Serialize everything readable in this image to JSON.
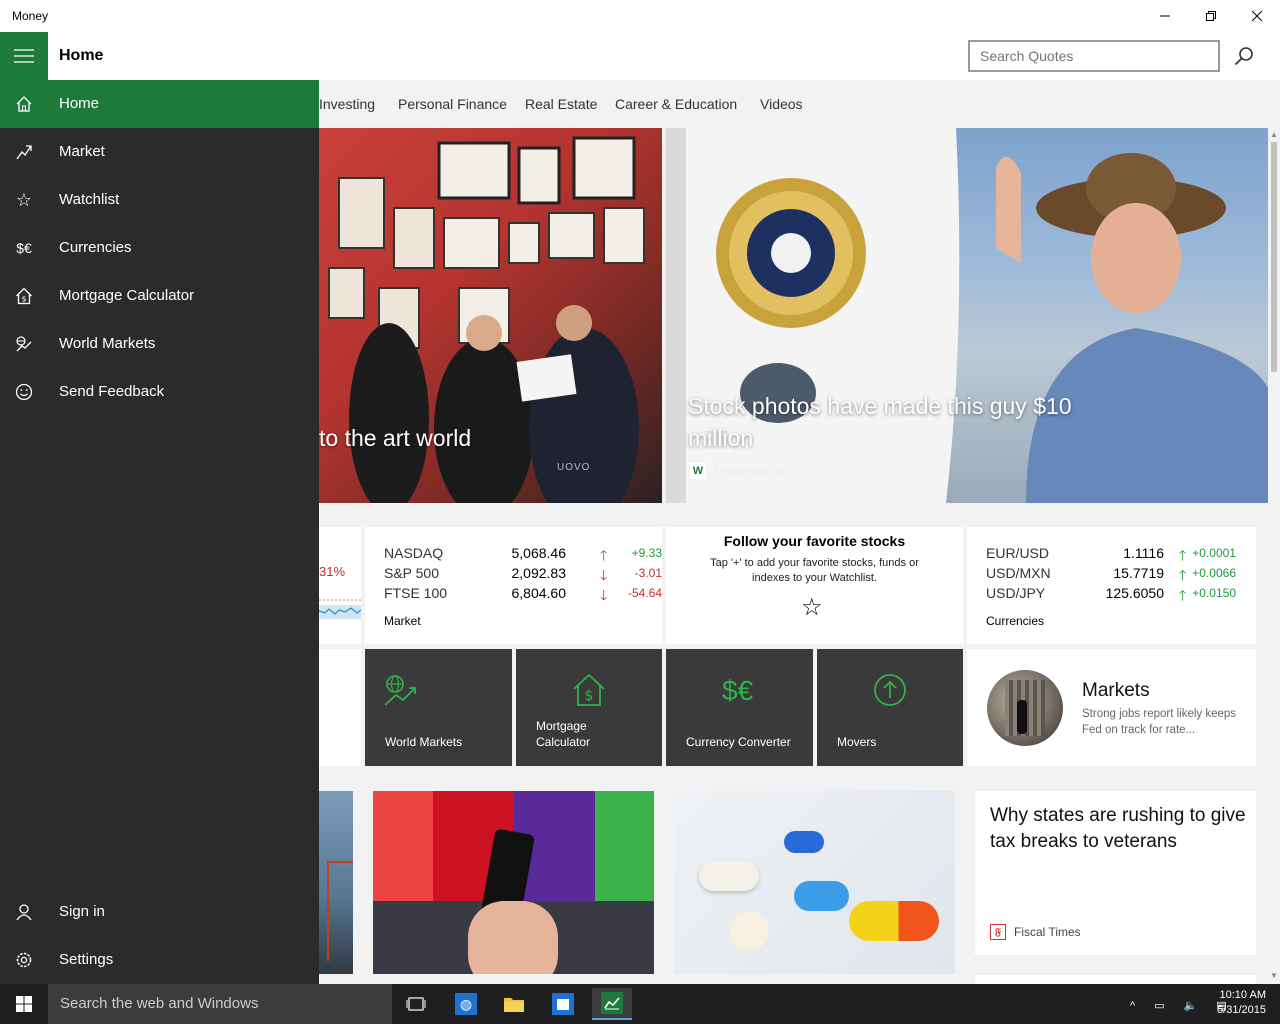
{
  "window": {
    "title": "Money"
  },
  "header": {
    "title": "Home",
    "search_placeholder": "Search Quotes"
  },
  "tabs": [
    "Investing",
    "Personal Finance",
    "Real Estate",
    "Career & Education",
    "Videos"
  ],
  "hero": {
    "left_headline": "to the art world",
    "right_headline": "Stock photos have made this guy $10 million",
    "right_source": "MarketWatch",
    "left_watermark": "UOVO"
  },
  "market_card": {
    "partial_pct": "31%",
    "rows": [
      {
        "name": "NASDAQ",
        "value": "5,068.46",
        "direction": "up",
        "change": "+9.33"
      },
      {
        "name": "S&P 500",
        "value": "2,092.83",
        "direction": "down",
        "change": "-3.01"
      },
      {
        "name": "FTSE 100",
        "value": "6,804.60",
        "direction": "down",
        "change": "-54.64"
      }
    ],
    "label": "Market"
  },
  "watchlist_card": {
    "title": "Follow your favorite stocks",
    "body": "Tap '+' to add your favorite stocks, funds or indexes to your Watchlist."
  },
  "currencies_card": {
    "rows": [
      {
        "name": "EUR/USD",
        "value": "1.1116",
        "direction": "up",
        "change": "+0.0001"
      },
      {
        "name": "USD/MXN",
        "value": "15.7719",
        "direction": "up",
        "change": "+0.0066"
      },
      {
        "name": "USD/JPY",
        "value": "125.6050",
        "direction": "up",
        "change": "+0.0150"
      }
    ],
    "label": "Currencies"
  },
  "tiles": {
    "world_markets": "World Markets",
    "mortgage_line1": "Mortgage",
    "mortgage_line2": "Calculator",
    "currency_converter": "Currency Converter",
    "movers": "Movers"
  },
  "markets_news": {
    "title": "Markets",
    "body": "Strong jobs report likely keeps Fed on track for rate..."
  },
  "article": {
    "headline": "Why states are rushing to give tax breaks to veterans",
    "source": "Fiscal Times"
  },
  "nav": {
    "items": [
      {
        "label": "Home",
        "icon": "home-icon"
      },
      {
        "label": "Market",
        "icon": "market-chart-icon"
      },
      {
        "label": "Watchlist",
        "icon": "star-icon"
      },
      {
        "label": "Currencies",
        "icon": "currency-icon"
      },
      {
        "label": "Mortgage Calculator",
        "icon": "mortgage-icon"
      },
      {
        "label": "World Markets",
        "icon": "globe-chart-icon"
      },
      {
        "label": "Send Feedback",
        "icon": "smiley-icon"
      }
    ],
    "sign_in": "Sign in",
    "settings": "Settings",
    "currency_glyph": "$€"
  },
  "taskbar": {
    "search_placeholder": "Search the web and Windows",
    "time": "10:10 AM",
    "date": "5/31/2015"
  },
  "colors": {
    "accent": "#1e7a3a",
    "nav_bg": "#2b2b2b",
    "tile_bg": "#3a3a3a",
    "up": "#1e9a3a",
    "down": "#c0302a"
  }
}
